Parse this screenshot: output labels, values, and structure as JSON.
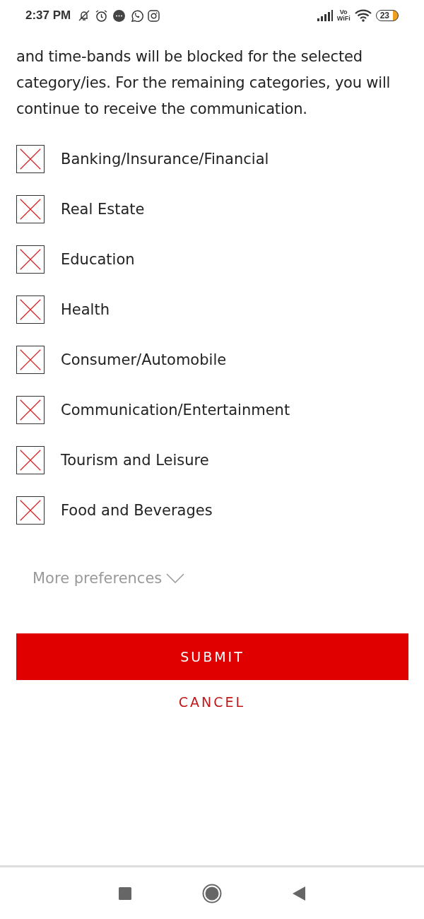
{
  "status_bar": {
    "time": "2:37 PM",
    "vowifi_top": "Vo",
    "vowifi_bottom": "WiFi",
    "battery": "23"
  },
  "intro_lines": [
    "and time-bands will be blocked for the selected",
    "category/ies. For the remaining categories, you will",
    "continue to receive the communication."
  ],
  "categories": [
    {
      "label": "Banking/Insurance/Financial",
      "checked": true
    },
    {
      "label": "Real Estate",
      "checked": true
    },
    {
      "label": "Education",
      "checked": true
    },
    {
      "label": "Health",
      "checked": true
    },
    {
      "label": "Consumer/Automobile",
      "checked": true
    },
    {
      "label": "Communication/Entertainment",
      "checked": true
    },
    {
      "label": "Tourism and Leisure",
      "checked": true
    },
    {
      "label": "Food and Beverages",
      "checked": true
    }
  ],
  "more_preferences": {
    "label": "More preferences",
    "expanded": false
  },
  "buttons": {
    "submit": "SUBMIT",
    "cancel": "CANCEL"
  }
}
